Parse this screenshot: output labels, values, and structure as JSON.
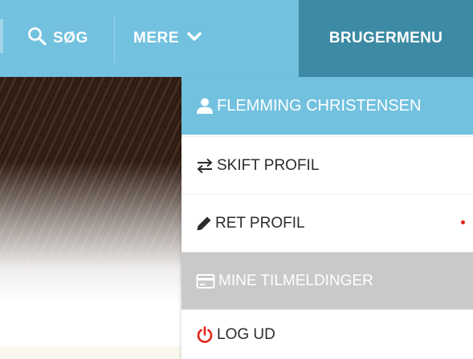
{
  "nav": {
    "search_label": "SØG",
    "more_label": "MERE",
    "user_menu_label": "BRUGERMENU"
  },
  "dropdown": {
    "user_name": "FLEMMING CHRISTENSEN",
    "switch_profile": "SKIFT PROFIL",
    "edit_profile": "RET PROFIL",
    "my_registrations": "MINE TILMELDINGER",
    "log_out": "LOG UD"
  },
  "icons": {
    "search": "search-icon",
    "more": "chevron-down-icon",
    "user": "user-icon",
    "switch": "swap-arrows-icon",
    "edit": "pencil-icon",
    "registrations": "card-icon",
    "logout": "power-icon"
  },
  "colors": {
    "nav_bar": "#72c1df",
    "user_menu_button": "#3c8aa3",
    "disabled_item": "#c9c9c9",
    "logout_icon": "#e2231a",
    "notification_dot": "#e2231a"
  }
}
